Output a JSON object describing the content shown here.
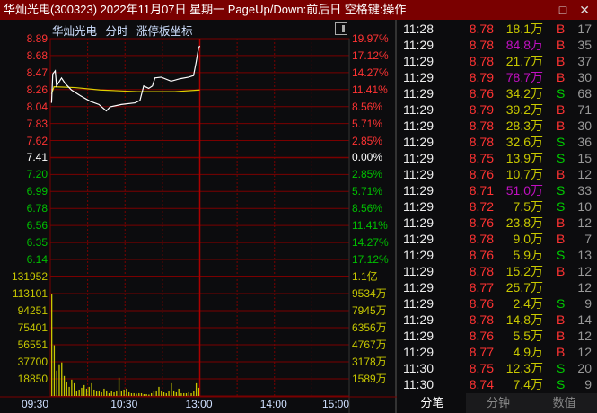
{
  "window": {
    "title": "华灿光电(300323) 2022年11月07日 星期一 PageUp/Down:前后日 空格键:操作",
    "maximize_icon": "□",
    "close_icon": "✕"
  },
  "chart": {
    "stock_name": "华灿光电",
    "mode": "分时",
    "axis_mode": "涨停板坐标",
    "prev_close": 7.41,
    "price_labels": [
      "8.89",
      "8.68",
      "8.47",
      "8.26",
      "8.04",
      "7.83",
      "7.62",
      "7.41",
      "7.20",
      "6.99",
      "6.78",
      "6.56",
      "6.35",
      "6.14"
    ],
    "pct_labels": [
      "19.97%",
      "17.12%",
      "14.27%",
      "11.41%",
      "8.56%",
      "5.71%",
      "2.85%",
      "0.00%",
      "2.85%",
      "5.71%",
      "8.56%",
      "11.41%",
      "14.27%",
      "17.12%"
    ],
    "vol_labels": [
      "131952",
      "113101",
      "94251",
      "75401",
      "56551",
      "37700",
      "18850"
    ],
    "amount_labels": [
      "1.1亿",
      "9534万",
      "7945万",
      "6356万",
      "4767万",
      "3178万",
      "1589万"
    ],
    "time_labels": [
      "09:30",
      "10:30",
      "13:00",
      "14:00",
      "15:00"
    ],
    "colors": {
      "up": "#ff3333",
      "down": "#00c000",
      "flat": "#ffffff",
      "avg": "#e0d000",
      "grid": "#7a0000",
      "vol": "#c8c800"
    },
    "price_series": [
      [
        1,
        8.09
      ],
      [
        2,
        8.45
      ],
      [
        4,
        8.49
      ],
      [
        5,
        8.3
      ],
      [
        7,
        8.35
      ],
      [
        9,
        8.4
      ],
      [
        12,
        8.33
      ],
      [
        17,
        8.25
      ],
      [
        24,
        8.18
      ],
      [
        32,
        8.11
      ],
      [
        39,
        8.07
      ],
      [
        45,
        7.99
      ],
      [
        48,
        8.04
      ],
      [
        57,
        8.07
      ],
      [
        68,
        8.09
      ],
      [
        72,
        8.12
      ],
      [
        75,
        8.3
      ],
      [
        79,
        8.27
      ],
      [
        82,
        8.3
      ],
      [
        84,
        8.4
      ],
      [
        89,
        8.41
      ],
      [
        97,
        8.36
      ],
      [
        104,
        8.39
      ],
      [
        111,
        8.41
      ],
      [
        115,
        8.43
      ],
      [
        117,
        8.59
      ],
      [
        119,
        8.77
      ],
      [
        120,
        8.8
      ]
    ],
    "avg_series": [
      [
        1,
        8.2
      ],
      [
        3,
        8.29
      ],
      [
        20,
        8.28
      ],
      [
        40,
        8.25
      ],
      [
        70,
        8.23
      ],
      [
        100,
        8.23
      ],
      [
        120,
        8.25
      ]
    ],
    "volume_series": [
      113000,
      56000,
      28000,
      35000,
      37000,
      22000,
      15000,
      10000,
      18000,
      14000,
      6000,
      7000,
      9000,
      12000,
      8000,
      10000,
      14000,
      7000,
      5000,
      6000,
      4000,
      8000,
      6000,
      3000,
      5000,
      4000,
      6000,
      20000,
      5000,
      7000,
      8000,
      4000,
      3000,
      3000,
      2500,
      3000,
      3000,
      2000,
      2000,
      1500,
      3000,
      5000,
      6000,
      10000,
      5000,
      4000,
      3000,
      5000,
      14000,
      6000,
      4000,
      8000,
      3000,
      3000,
      3000,
      4000,
      3000,
      5000,
      14000,
      9000
    ]
  },
  "ticks": [
    {
      "time": "11:28",
      "price": "8.78",
      "vol": "18.1万",
      "dir": "B",
      "num": "17",
      "big": false
    },
    {
      "time": "11:29",
      "price": "8.78",
      "vol": "84.8万",
      "dir": "B",
      "num": "35",
      "big": true
    },
    {
      "time": "11:29",
      "price": "8.78",
      "vol": "21.7万",
      "dir": "B",
      "num": "37",
      "big": false
    },
    {
      "time": "11:29",
      "price": "8.79",
      "vol": "78.7万",
      "dir": "B",
      "num": "30",
      "big": true
    },
    {
      "time": "11:29",
      "price": "8.76",
      "vol": "34.2万",
      "dir": "S",
      "num": "68",
      "big": false
    },
    {
      "time": "11:29",
      "price": "8.79",
      "vol": "39.2万",
      "dir": "B",
      "num": "71",
      "big": false
    },
    {
      "time": "11:29",
      "price": "8.78",
      "vol": "28.3万",
      "dir": "B",
      "num": "30",
      "big": false
    },
    {
      "time": "11:29",
      "price": "8.78",
      "vol": "32.6万",
      "dir": "S",
      "num": "36",
      "big": false
    },
    {
      "time": "11:29",
      "price": "8.75",
      "vol": "13.9万",
      "dir": "S",
      "num": "15",
      "big": false
    },
    {
      "time": "11:29",
      "price": "8.76",
      "vol": "10.7万",
      "dir": "B",
      "num": "12",
      "big": false
    },
    {
      "time": "11:29",
      "price": "8.71",
      "vol": "51.0万",
      "dir": "S",
      "num": "33",
      "big": true
    },
    {
      "time": "11:29",
      "price": "8.72",
      "vol": "7.5万",
      "dir": "S",
      "num": "10",
      "big": false
    },
    {
      "time": "11:29",
      "price": "8.76",
      "vol": "23.8万",
      "dir": "B",
      "num": "12",
      "big": false
    },
    {
      "time": "11:29",
      "price": "8.78",
      "vol": "9.0万",
      "dir": "B",
      "num": "7",
      "big": false
    },
    {
      "time": "11:29",
      "price": "8.76",
      "vol": "5.9万",
      "dir": "S",
      "num": "13",
      "big": false
    },
    {
      "time": "11:29",
      "price": "8.78",
      "vol": "15.2万",
      "dir": "B",
      "num": "12",
      "big": false
    },
    {
      "time": "11:29",
      "price": "8.77",
      "vol": "25.7万",
      "dir": "",
      "num": "12",
      "big": false
    },
    {
      "time": "11:29",
      "price": "8.76",
      "vol": "2.4万",
      "dir": "S",
      "num": "9",
      "big": false
    },
    {
      "time": "11:29",
      "price": "8.78",
      "vol": "14.8万",
      "dir": "B",
      "num": "14",
      "big": false
    },
    {
      "time": "11:29",
      "price": "8.76",
      "vol": "5.5万",
      "dir": "B",
      "num": "12",
      "big": false
    },
    {
      "time": "11:29",
      "price": "8.77",
      "vol": "4.9万",
      "dir": "B",
      "num": "12",
      "big": false
    },
    {
      "time": "11:30",
      "price": "8.75",
      "vol": "12.3万",
      "dir": "S",
      "num": "20",
      "big": false
    },
    {
      "time": "11:30",
      "price": "8.74",
      "vol": "7.4万",
      "dir": "S",
      "num": "9",
      "big": false
    }
  ],
  "tabs": [
    "分笔",
    "分钟",
    "数值"
  ]
}
